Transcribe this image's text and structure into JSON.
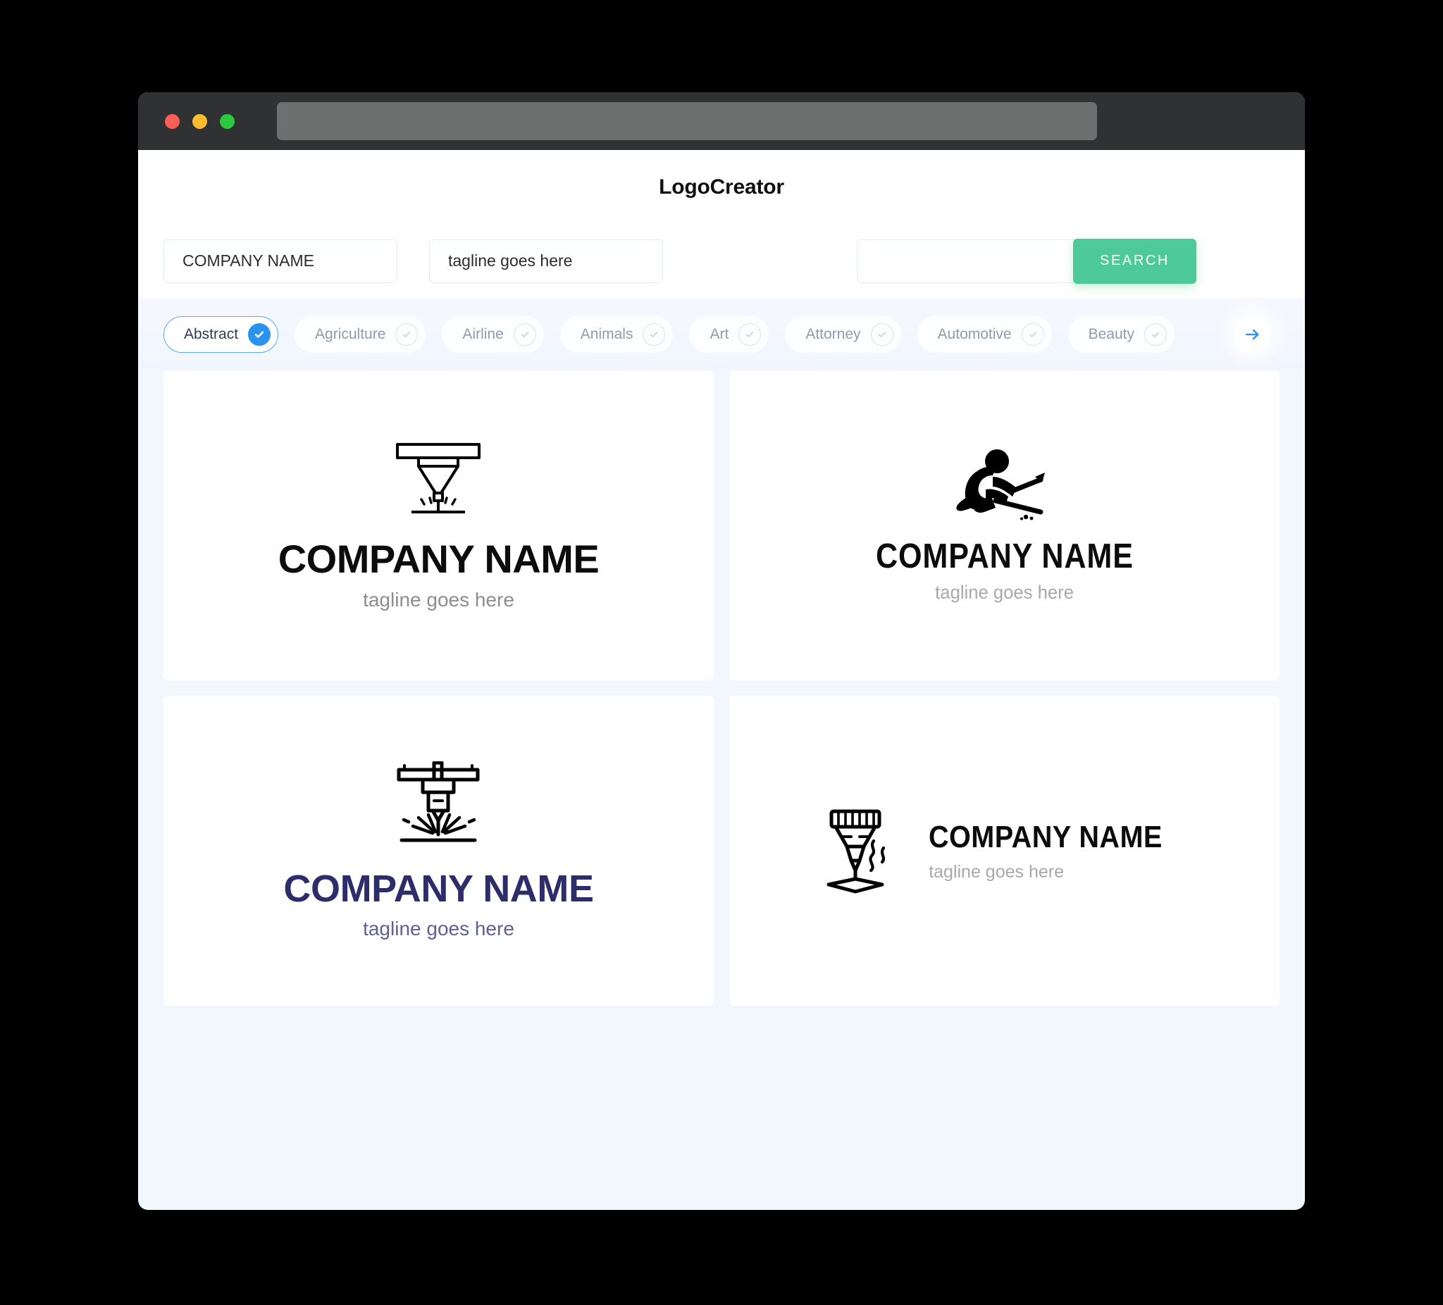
{
  "window": {
    "traffic_lights": [
      "close",
      "minimize",
      "maximize"
    ],
    "url_value": ""
  },
  "header": {
    "app_title": "LogoCreator"
  },
  "search": {
    "company_name_value": "COMPANY NAME",
    "company_name_placeholder": "COMPANY NAME",
    "tagline_value": "tagline goes here",
    "tagline_placeholder": "tagline goes here",
    "extra_value": "",
    "extra_placeholder": "",
    "search_button_label": "SEARCH",
    "accent_color": "#4ec99a"
  },
  "categories": {
    "selected": "Abstract",
    "next_icon": "arrow-right-icon",
    "accent_color": "#2a93f0",
    "items": [
      {
        "label": "Abstract",
        "selected": true
      },
      {
        "label": "Agriculture",
        "selected": false
      },
      {
        "label": "Airline",
        "selected": false
      },
      {
        "label": "Animals",
        "selected": false
      },
      {
        "label": "Art",
        "selected": false
      },
      {
        "label": "Attorney",
        "selected": false
      },
      {
        "label": "Automotive",
        "selected": false
      },
      {
        "label": "Beauty",
        "selected": false
      }
    ]
  },
  "logos": [
    {
      "id": "card1",
      "icon": "laser-cutter-nozzle-icon",
      "name": "COMPANY NAME",
      "tagline": "tagline goes here",
      "name_color": "#0c0c0c",
      "tagline_color": "#8d8d8d",
      "layout": "stacked"
    },
    {
      "id": "card2",
      "icon": "kneeling-welder-worker-icon",
      "name": "COMPANY NAME",
      "tagline": "tagline goes here",
      "name_color": "#0c0c0c",
      "tagline_color": "#a9a9a9",
      "layout": "stacked"
    },
    {
      "id": "card3",
      "icon": "cnc-laser-head-sparks-icon",
      "name": "COMPANY NAME",
      "tagline": "tagline goes here",
      "name_color": "#2d2d6b",
      "tagline_color": "#5f5f98",
      "layout": "stacked"
    },
    {
      "id": "card4",
      "icon": "laser-cutter-smoke-icon",
      "name": "COMPANY NAME",
      "tagline": "tagline goes here",
      "name_color": "#0c0c0c",
      "tagline_color": "#a9a9a9",
      "layout": "horizontal"
    }
  ]
}
